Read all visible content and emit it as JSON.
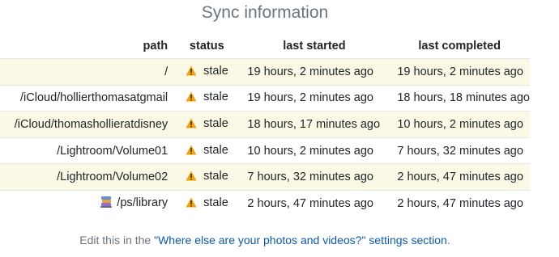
{
  "title": "Sync information",
  "columns": {
    "path": "path",
    "status": "status",
    "last_started": "last started",
    "last_completed": "last completed"
  },
  "rows": [
    {
      "path": "/",
      "status": "stale",
      "last_started": "19 hours, 2 minutes ago",
      "last_completed": "19 hours, 2 minutes ago",
      "icon": null
    },
    {
      "path": "/iCloud/hollierthomasatgmail",
      "status": "stale",
      "last_started": "19 hours, 2 minutes ago",
      "last_completed": "18 hours, 18 minutes ago",
      "icon": null
    },
    {
      "path": "/iCloud/thomashollieratdisney",
      "status": "stale",
      "last_started": "18 hours, 17 minutes ago",
      "last_completed": "10 hours, 2 minutes ago",
      "icon": null
    },
    {
      "path": "/Lightroom/Volume01",
      "status": "stale",
      "last_started": "10 hours, 2 minutes ago",
      "last_completed": "7 hours, 32 minutes ago",
      "icon": null
    },
    {
      "path": "/Lightroom/Volume02",
      "status": "stale",
      "last_started": "7 hours, 32 minutes ago",
      "last_completed": "2 hours, 47 minutes ago",
      "icon": null
    },
    {
      "path": "/ps/library",
      "status": "stale",
      "last_started": "2 hours, 47 minutes ago",
      "last_completed": "2 hours, 47 minutes ago",
      "icon": "library-books-icon"
    }
  ],
  "status_icon": "warning-icon",
  "footer": {
    "prefix": "Edit this in the ",
    "link": "\"Where else are your photos and videos?\" settings section",
    "suffix": "."
  },
  "colors": {
    "stripe": "#fbf9e6",
    "link": "#0d5aa7",
    "muted": "#6c757d",
    "warning": "#f0a30a"
  }
}
